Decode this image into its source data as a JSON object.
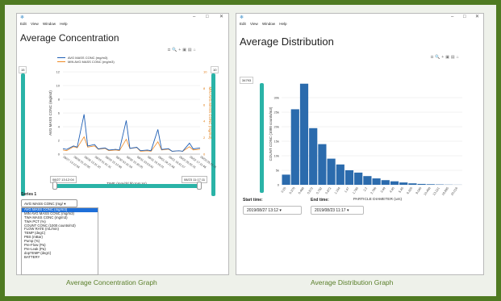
{
  "left_window": {
    "menu": [
      "Edit",
      "View",
      "Window",
      "Help"
    ],
    "title": "Average Concentration",
    "legend": [
      {
        "label": "AVG MASS CONC (mg/m3)",
        "color": "#1f5fb5"
      },
      {
        "label": "MIN AVG MASS CONC (mg/m3)",
        "color": "#f08a24"
      }
    ],
    "y_left_label": "AVG MASS CONC (mg/m3)",
    "y_right_label": "MIN AVG MASS CONC (mg/m3)",
    "x_label": "TIME (mm/dd hh:mm:ss)",
    "y_left_max_box": "15",
    "y_right_max_box": "10",
    "y_left_ticks": [
      "12",
      "10",
      "8",
      "6",
      "4",
      "2",
      "0"
    ],
    "y_right_ticks": [
      "10",
      "8",
      "6",
      "4",
      "2",
      "0"
    ],
    "x_ticks": [
      "08/27 13:12:04",
      "08/28 01:22:06",
      "08/28 13:31:20",
      "08/29 01:41:31",
      "08/29 15:12:48",
      "08/30 03:31:54",
      "08/30 15:35:05",
      "08/31 03:53:42",
      "08/31 16:10:01",
      "09/01 04:21:48",
      "09/01 16:41:57",
      "09/02 05:00:15",
      "09/02 17:11:48",
      "09/03 05:01:11"
    ],
    "range_start": "08/27 13:12:04",
    "range_end": "08/23 11:17:11",
    "series_label": "Series 1",
    "series_selected": "AVG MASS CONC (mg/",
    "series_options": [
      "AVG MASS CONC (mg/m3)",
      "MIN AVG MASS CONC (mg/m3)",
      "TWA MASS CONC (mg/m3)",
      "TWA PCT (%)",
      "COUNT CONC (1000 counts/m3)",
      "FLOW RATE (mL/min)",
      "TEMP (degC)",
      "PBS (mBar)",
      "Pump (%)",
      "Pre-Flow (Pa)",
      "Pre-Leak (Pa)",
      "dopTEMP (degC)",
      "BATTERY"
    ],
    "caption": "Average Concentration Graph"
  },
  "right_window": {
    "menu": [
      "Edit",
      "View",
      "Window",
      "Help"
    ],
    "title": "Average Distribution",
    "y_label": "COUNT CONC (1000 counts/m3)",
    "x_label": "PARTICLE DIAMETER (um)",
    "y_max_box": "34793",
    "start_label": "Start time:",
    "start_value": "2019/08/27 13:12",
    "end_label": "End time:",
    "end_value": "2019/08/23 11:17",
    "caption": "Average Distribution Graph"
  },
  "chart_data": [
    {
      "type": "line",
      "x": [
        "08/27 13:12:04",
        "08/28 01:22:06",
        "08/28 13:31:20",
        "08/29 01:41:31",
        "08/29 15:12:48",
        "08/30 03:31:54",
        "08/30 15:35:05",
        "08/31 03:53:42",
        "08/31 16:10:01",
        "09/01 04:21:48",
        "09/01 16:41:57",
        "09/02 05:00:15",
        "09/02 17:11:48",
        "09/03 05:01:11"
      ],
      "series": [
        {
          "name": "AVG MASS CONC (mg/m3)",
          "values": [
            0.8,
            1.2,
            5.8,
            1.4,
            0.9,
            0.7,
            4.9,
            1.0,
            0.6,
            3.6,
            0.8,
            0.5,
            1.6,
            0.9
          ]
        },
        {
          "name": "MIN AVG MASS CONC (mg/m3)",
          "values": [
            0.5,
            0.9,
            2.1,
            1.0,
            0.7,
            0.5,
            1.8,
            0.8,
            0.4,
            1.5,
            0.6,
            0.4,
            0.9,
            0.6
          ]
        }
      ],
      "ylim": [
        0,
        12
      ],
      "y2lim": [
        0,
        10
      ]
    },
    {
      "type": "bar",
      "categories": [
        "0.25",
        "0.375",
        "0.488",
        "0.572",
        "0.752",
        "0.872",
        "1.154",
        "1.47",
        "1.785",
        "2.2",
        "2.786",
        "3.49",
        "4.45",
        "5.45",
        "6.325",
        "9.045",
        "10.458",
        "13.221",
        "16.895",
        "20.016"
      ],
      "values": [
        3500,
        26000,
        34800,
        19500,
        14000,
        9000,
        7000,
        5000,
        4200,
        3000,
        2200,
        1600,
        1200,
        800,
        500,
        300,
        200,
        120,
        60,
        30
      ],
      "ylim": [
        0,
        35000
      ],
      "y_ticks": [
        "30k",
        "25k",
        "20k",
        "15k",
        "10k",
        "5k",
        "0"
      ]
    }
  ],
  "colors": {
    "accent": "#2ab3a7",
    "frame": "#4f7a22",
    "bar": "#2b6bad"
  }
}
